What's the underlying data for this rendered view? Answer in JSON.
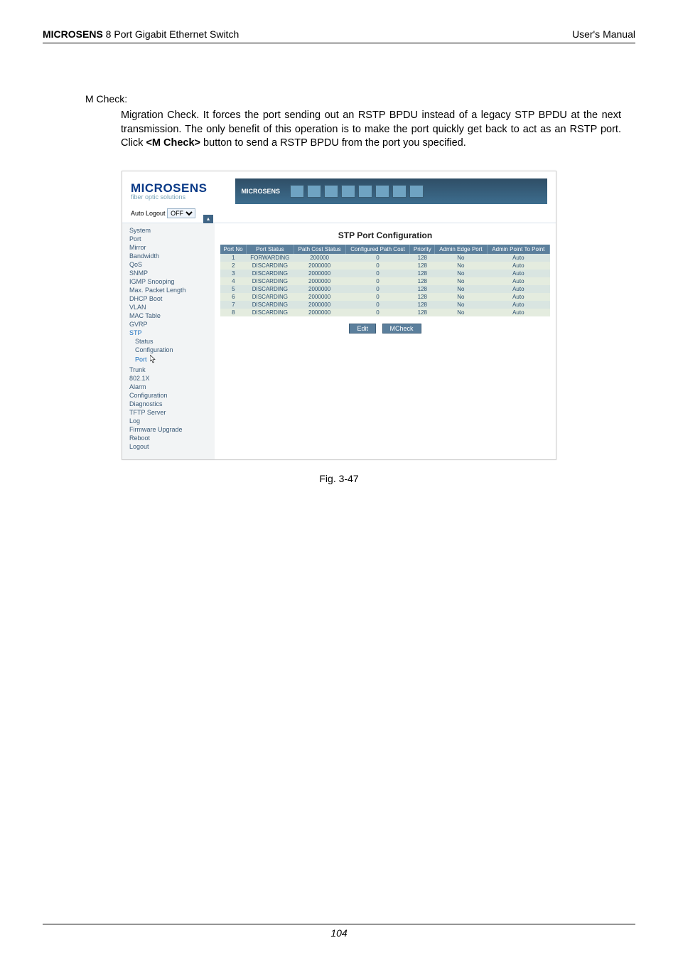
{
  "header": {
    "brand": "MICROSENS",
    "product": " 8 Port Gigabit Ethernet Switch",
    "right": "User's Manual"
  },
  "section": {
    "label": "M Check:",
    "body_pre": "Migration Check. It forces the port sending out an RSTP BPDU instead of a legacy STP BPDU at the next transmission. The only benefit of this operation is to make the port quickly get back to act as an RSTP port. Click ",
    "body_bold": "<M Check>",
    "body_post": " button to send a RSTP BPDU from the port you specified."
  },
  "shot": {
    "brand_line1": "MICROSENS",
    "brand_line2": "fiber optic solutions",
    "banner_label": "MICROSENS",
    "autologout_label": "Auto Logout",
    "autologout_value": "OFF",
    "nav": [
      "System",
      "Port",
      "Mirror",
      "Bandwidth",
      "QoS",
      "SNMP",
      "IGMP Snooping",
      "Max. Packet Length",
      "DHCP Boot",
      "VLAN",
      "MAC Table",
      "GVRP"
    ],
    "nav_stp": "STP",
    "nav_stp_sub": [
      "Status",
      "Configuration",
      "Port"
    ],
    "nav_after": [
      "Trunk",
      "802.1X",
      "Alarm",
      "Configuration",
      "Diagnostics",
      "TFTP Server",
      "Log",
      "Firmware Upgrade",
      "Reboot",
      "Logout"
    ],
    "content_title": "STP Port Configuration",
    "cols": [
      "Port No",
      "Port Status",
      "Path Cost Status",
      "Configured Path Cost",
      "Priority",
      "Admin Edge Port",
      "Admin Point To Point"
    ],
    "rows": [
      {
        "no": "1",
        "status": "FORWARDING",
        "pcs": "200000",
        "cpc": "0",
        "prio": "128",
        "edge": "No",
        "p2p": "Auto"
      },
      {
        "no": "2",
        "status": "DISCARDING",
        "pcs": "2000000",
        "cpc": "0",
        "prio": "128",
        "edge": "No",
        "p2p": "Auto"
      },
      {
        "no": "3",
        "status": "DISCARDING",
        "pcs": "2000000",
        "cpc": "0",
        "prio": "128",
        "edge": "No",
        "p2p": "Auto"
      },
      {
        "no": "4",
        "status": "DISCARDING",
        "pcs": "2000000",
        "cpc": "0",
        "prio": "128",
        "edge": "No",
        "p2p": "Auto"
      },
      {
        "no": "5",
        "status": "DISCARDING",
        "pcs": "2000000",
        "cpc": "0",
        "prio": "128",
        "edge": "No",
        "p2p": "Auto"
      },
      {
        "no": "6",
        "status": "DISCARDING",
        "pcs": "2000000",
        "cpc": "0",
        "prio": "128",
        "edge": "No",
        "p2p": "Auto"
      },
      {
        "no": "7",
        "status": "DISCARDING",
        "pcs": "2000000",
        "cpc": "0",
        "prio": "128",
        "edge": "No",
        "p2p": "Auto"
      },
      {
        "no": "8",
        "status": "DISCARDING",
        "pcs": "2000000",
        "cpc": "0",
        "prio": "128",
        "edge": "No",
        "p2p": "Auto"
      }
    ],
    "btn_edit": "Edit",
    "btn_mcheck": "MCheck"
  },
  "caption": "Fig. 3-47",
  "page_number": "104"
}
